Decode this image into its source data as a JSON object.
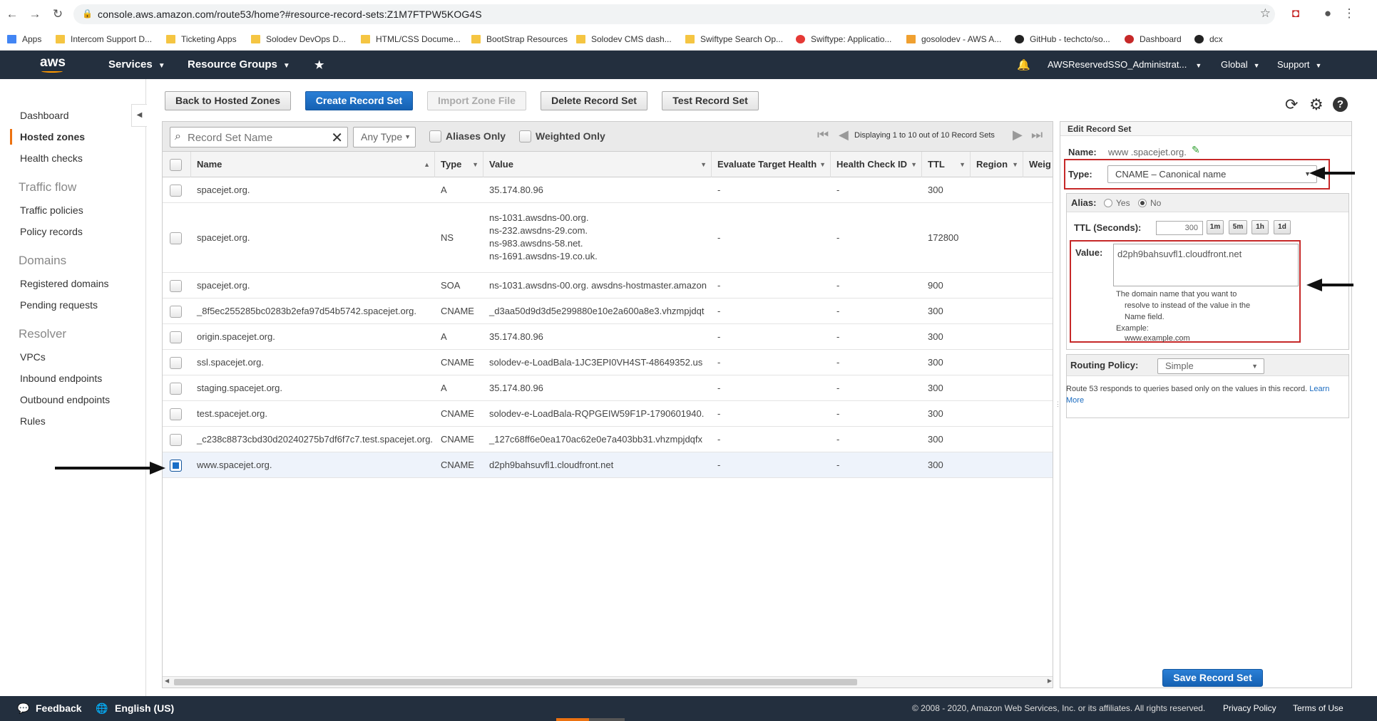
{
  "browser": {
    "url": "console.aws.amazon.com/route53/home?#resource-record-sets:Z1M7FTPW5KOG4S",
    "bookmarks": [
      "Apps",
      "Intercom Support D...",
      "Ticketing Apps",
      "Solodev DevOps D...",
      "HTML/CSS Docume...",
      "BootStrap Resources",
      "Solodev CMS dash...",
      "Swiftype Search Op...",
      "Swiftype: Applicatio...",
      "gosolodev - AWS A...",
      "GitHub - techcto/so...",
      "Dashboard",
      "dcx"
    ]
  },
  "aws_nav": {
    "logo": "aws",
    "services": "Services",
    "resource_groups": "Resource Groups",
    "account": "AWSReservedSSO_Administrat...",
    "region": "Global",
    "support": "Support"
  },
  "sidebar": {
    "items": [
      "Dashboard",
      "Hosted zones",
      "Health checks"
    ],
    "traffic_heading": "Traffic flow",
    "traffic_items": [
      "Traffic policies",
      "Policy records"
    ],
    "domains_heading": "Domains",
    "domains_items": [
      "Registered domains",
      "Pending requests"
    ],
    "resolver_heading": "Resolver",
    "resolver_items": [
      "VPCs",
      "Inbound endpoints",
      "Outbound endpoints",
      "Rules"
    ]
  },
  "toolbar": {
    "back": "Back to Hosted Zones",
    "create": "Create Record Set",
    "import": "Import Zone File",
    "delete": "Delete Record Set",
    "test": "Test Record Set"
  },
  "filters": {
    "search_placeholder": "Record Set Name",
    "type": "Any Type",
    "aliases": "Aliases Only",
    "weighted": "Weighted Only",
    "pager": "Displaying 1 to 10 out of 10 Record Sets"
  },
  "columns": [
    "Name",
    "Type",
    "Value",
    "Evaluate Target Health",
    "Health Check ID",
    "TTL",
    "Region",
    "Weig"
  ],
  "records": [
    {
      "name": "spacejet.org.",
      "type": "A",
      "value": [
        "35.174.80.96"
      ],
      "eval": "-",
      "hc": "-",
      "ttl": "300"
    },
    {
      "name": "spacejet.org.",
      "type": "NS",
      "value": [
        "ns-1031.awsdns-00.org.",
        "ns-232.awsdns-29.com.",
        "ns-983.awsdns-58.net.",
        "ns-1691.awsdns-19.co.uk."
      ],
      "eval": "-",
      "hc": "-",
      "ttl": "172800"
    },
    {
      "name": "spacejet.org.",
      "type": "SOA",
      "value": [
        "ns-1031.awsdns-00.org. awsdns-hostmaster.amazon"
      ],
      "eval": "-",
      "hc": "-",
      "ttl": "900"
    },
    {
      "name": "_8f5ec255285bc0283b2efa97d54b5742.spacejet.org.",
      "type": "CNAME",
      "value": [
        "_d3aa50d9d3d5e299880e10e2a600a8e3.vhzmpjdqt"
      ],
      "eval": "-",
      "hc": "-",
      "ttl": "300"
    },
    {
      "name": "origin.spacejet.org.",
      "type": "A",
      "value": [
        "35.174.80.96"
      ],
      "eval": "-",
      "hc": "-",
      "ttl": "300"
    },
    {
      "name": "ssl.spacejet.org.",
      "type": "CNAME",
      "value": [
        "solodev-e-LoadBala-1JC3EPI0VH4ST-48649352.us"
      ],
      "eval": "-",
      "hc": "-",
      "ttl": "300"
    },
    {
      "name": "staging.spacejet.org.",
      "type": "A",
      "value": [
        "35.174.80.96"
      ],
      "eval": "-",
      "hc": "-",
      "ttl": "300"
    },
    {
      "name": "test.spacejet.org.",
      "type": "CNAME",
      "value": [
        "solodev-e-LoadBala-RQPGEIW59F1P-1790601940."
      ],
      "eval": "-",
      "hc": "-",
      "ttl": "300"
    },
    {
      "name": "_c238c8873cbd30d20240275b7df6f7c7.test.spacejet.org.",
      "type": "CNAME",
      "value": [
        "_127c68ff6e0ea170ac62e0e7a403bb31.vhzmpjdqfx"
      ],
      "eval": "-",
      "hc": "-",
      "ttl": "300"
    },
    {
      "name": "www.spacejet.org.",
      "type": "CNAME",
      "value": [
        "d2ph9bahsuvfl1.cloudfront.net"
      ],
      "eval": "-",
      "hc": "-",
      "ttl": "300",
      "selected": true
    }
  ],
  "edit": {
    "title": "Edit Record Set",
    "name_label": "Name:",
    "name_value": "www .spacejet.org.",
    "type_label": "Type:",
    "type_value": "CNAME – Canonical name",
    "alias_label": "Alias:",
    "alias_yes": "Yes",
    "alias_no": "No",
    "ttl_label": "TTL (Seconds):",
    "ttl_value": "300",
    "ttl_buttons": [
      "1m",
      "5m",
      "1h",
      "1d"
    ],
    "value_label": "Value:",
    "value": "d2ph9bahsuvfl1.cloudfront.net",
    "value_help": [
      "The domain name that you want to",
      "resolve to instead of the value in the",
      "Name field.",
      "Example:",
      "www.example.com"
    ],
    "routing_label": "Routing Policy:",
    "routing_value": "Simple",
    "routing_help": "Route 53 responds to queries based only on the values in this record.",
    "learn_more": "Learn More",
    "save": "Save Record Set"
  },
  "footer": {
    "feedback": "Feedback",
    "language": "English (US)",
    "copyright": "© 2008 - 2020, Amazon Web Services, Inc. or its affiliates. All rights reserved.",
    "privacy": "Privacy Policy",
    "terms": "Terms of Use"
  },
  "colors": {
    "aws_nav": "#232f3e",
    "primary_button": "#1a6fc7",
    "active_accent": "#ec7211",
    "annotation_box": "#c62828"
  }
}
